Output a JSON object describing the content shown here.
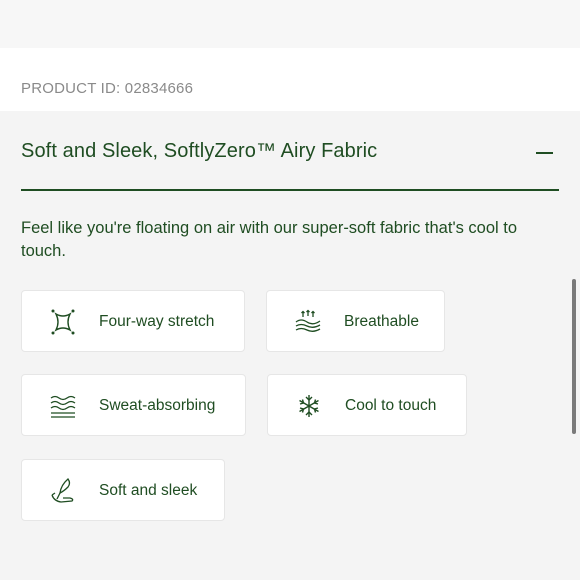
{
  "product": {
    "id_text": "PRODUCT ID: 02834666"
  },
  "section": {
    "title": "Soft and Sleek, SoftlyZero™ Airy Fabric",
    "description": "Feel like you're floating on air with our super-soft fabric that's cool to touch.",
    "accent_color": "#1f4d22"
  },
  "features": [
    {
      "label": "Four-way stretch",
      "icon": "stretch-icon"
    },
    {
      "label": "Breathable",
      "icon": "breathable-icon"
    },
    {
      "label": "Sweat-absorbing",
      "icon": "waves-icon"
    },
    {
      "label": "Cool to touch",
      "icon": "snowflake-icon"
    },
    {
      "label": "Soft and sleek",
      "icon": "hand-feather-icon"
    }
  ]
}
